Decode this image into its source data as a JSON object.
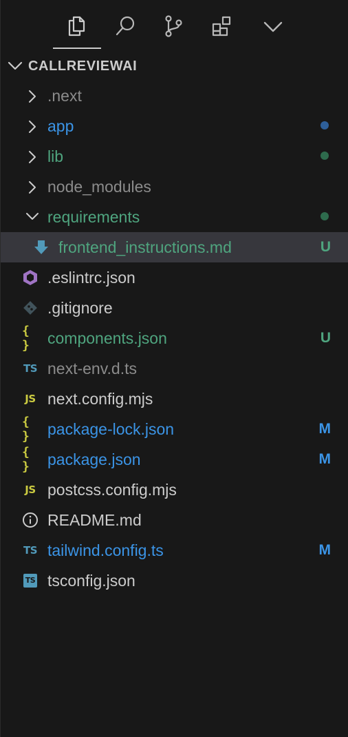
{
  "colors": {
    "default": "#cccccc",
    "dimmed": "#8b8b8b",
    "modified_blue": "#3b94e6",
    "untracked_green": "#4fa57f",
    "dot_blue": "#2e5f99",
    "dot_green": "#2e6b4d",
    "selected_bg": "#37373d"
  },
  "tabs": [
    {
      "name": "explorer",
      "icon": "files-icon",
      "active": true
    },
    {
      "name": "search",
      "icon": "search-icon",
      "active": false
    },
    {
      "name": "source-control",
      "icon": "source-control-icon",
      "active": false
    },
    {
      "name": "extensions",
      "icon": "extensions-icon",
      "active": false
    },
    {
      "name": "more",
      "icon": "chevron-down-icon",
      "active": false
    }
  ],
  "explorer": {
    "section_title": "CALLREVIEWAI",
    "items": [
      {
        "label": ".next",
        "type": "folder",
        "expanded": false,
        "color": "dimmed"
      },
      {
        "label": "app",
        "type": "folder",
        "expanded": false,
        "color": "modified_blue",
        "dot": "dot_blue"
      },
      {
        "label": "lib",
        "type": "folder",
        "expanded": false,
        "color": "untracked_green",
        "dot": "dot_green"
      },
      {
        "label": "node_modules",
        "type": "folder",
        "expanded": false,
        "color": "dimmed"
      },
      {
        "label": "requirements",
        "type": "folder",
        "expanded": true,
        "color": "untracked_green",
        "dot": "dot_green"
      },
      {
        "label": "frontend_instructions.md",
        "type": "file",
        "icon": "markdown-download-icon",
        "color": "untracked_green",
        "badge": "U",
        "nested": true,
        "selected": true
      },
      {
        "label": ".eslintrc.json",
        "type": "file",
        "icon": "eslint-icon",
        "color": "default"
      },
      {
        "label": ".gitignore",
        "type": "file",
        "icon": "git-icon",
        "color": "default"
      },
      {
        "label": "components.json",
        "type": "file",
        "icon": "json-icon",
        "icon_text": "{ }",
        "color": "untracked_green",
        "badge": "U"
      },
      {
        "label": "next-env.d.ts",
        "type": "file",
        "icon": "typescript-icon",
        "icon_text": "TS",
        "color": "dimmed"
      },
      {
        "label": "next.config.mjs",
        "type": "file",
        "icon": "javascript-icon",
        "icon_text": "JS",
        "color": "default"
      },
      {
        "label": "package-lock.json",
        "type": "file",
        "icon": "json-icon",
        "icon_text": "{ }",
        "color": "modified_blue",
        "badge": "M"
      },
      {
        "label": "package.json",
        "type": "file",
        "icon": "json-icon",
        "icon_text": "{ }",
        "color": "modified_blue",
        "badge": "M"
      },
      {
        "label": "postcss.config.mjs",
        "type": "file",
        "icon": "javascript-icon",
        "icon_text": "JS",
        "color": "default"
      },
      {
        "label": "README.md",
        "type": "file",
        "icon": "info-icon",
        "color": "default"
      },
      {
        "label": "tailwind.config.ts",
        "type": "file",
        "icon": "typescript-icon",
        "icon_text": "TS",
        "color": "modified_blue",
        "badge": "M"
      },
      {
        "label": "tsconfig.json",
        "type": "file",
        "icon": "tsconfig-icon",
        "icon_text": "TS",
        "color": "default"
      }
    ]
  }
}
